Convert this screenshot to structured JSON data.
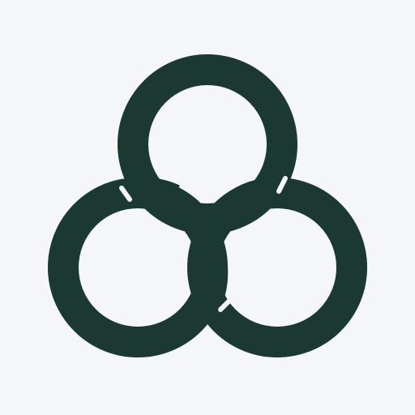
{
  "app_icon": {
    "icon": "triple-interlocking-rings-logo-icon",
    "colors": {
      "background": "#F4F6F8",
      "mark": "#1B3831"
    }
  }
}
